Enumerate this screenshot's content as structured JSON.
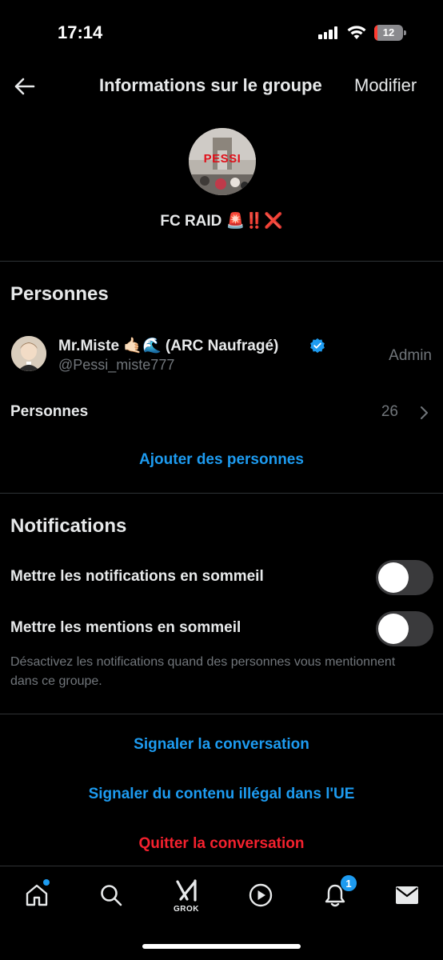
{
  "status_bar": {
    "time": "17:14",
    "battery_level": "12",
    "battery_fraction": 0.12
  },
  "header": {
    "back_icon": "arrow-left-icon",
    "title": "Informations sur le groupe",
    "edit_label": "Modifier"
  },
  "group": {
    "avatar_text": "PESSI",
    "name": "FC RAID 🚨‼️❌"
  },
  "people_section": {
    "title": "Personnes",
    "members": [
      {
        "name": "Mr.Miste 🤙🏻🌊 (ARC Naufragé)",
        "handle": "@Pessi_miste777",
        "role": "Admin",
        "verified": true
      }
    ],
    "people_label": "Personnes",
    "people_count": "26",
    "add_people_label": "Ajouter des personnes"
  },
  "notifications_section": {
    "title": "Notifications",
    "toggles": [
      {
        "label": "Mettre les notifications en sommeil",
        "on": false
      },
      {
        "label": "Mettre les mentions en sommeil",
        "on": false
      }
    ],
    "hint": "Désactivez les notifications quand des personnes vous mentionnent dans ce groupe."
  },
  "actions": {
    "report_conversation": "Signaler la conversation",
    "report_illegal": "Signaler du contenu illégal dans l'UE",
    "leave_conversation": "Quitter la conversation"
  },
  "bottom_nav": {
    "items": [
      {
        "icon": "home-icon",
        "has_dot": true
      },
      {
        "icon": "search-icon"
      },
      {
        "icon": "grok-icon",
        "label": "GROK"
      },
      {
        "icon": "play-icon"
      },
      {
        "icon": "bell-icon",
        "badge": "1"
      },
      {
        "icon": "mail-icon"
      }
    ]
  },
  "colors": {
    "background": "#000000",
    "text": "#e7e9ea",
    "muted": "#71767b",
    "accent": "#1d9bf0",
    "danger": "#f4212e",
    "divider": "#2f3336"
  }
}
